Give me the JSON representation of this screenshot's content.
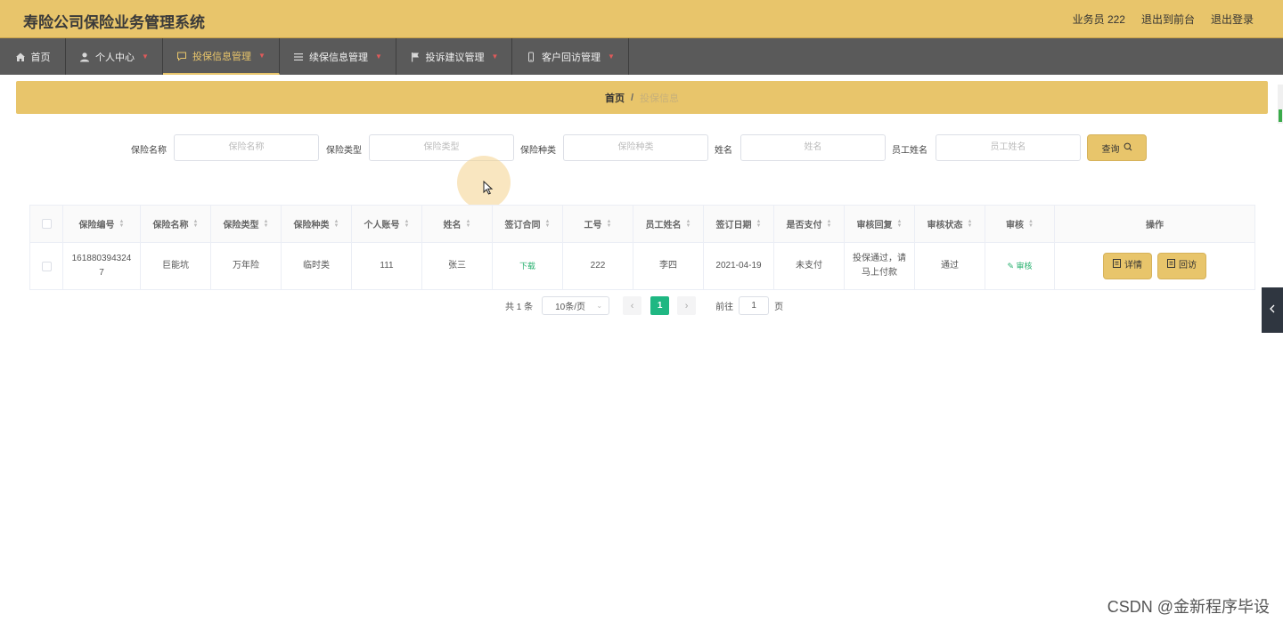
{
  "header": {
    "title": "寿险公司保险业务管理系统",
    "user_label": "业务员 222",
    "front_link": "退出到前台",
    "logout": "退出登录",
    "bg_color": "#e8c56b"
  },
  "nav": {
    "items": [
      {
        "label": "首页",
        "icon": "home-icon"
      },
      {
        "label": "个人中心",
        "icon": "user-icon"
      },
      {
        "label": "投保信息管理",
        "icon": "message-icon"
      },
      {
        "label": "续保信息管理",
        "icon": "list-icon"
      },
      {
        "label": "投诉建议管理",
        "icon": "flag-icon"
      },
      {
        "label": "客户回访管理",
        "icon": "phone-icon"
      }
    ],
    "active_index": 2,
    "bg_color": "#5a5a5a"
  },
  "breadcrumb": {
    "home": "首页",
    "separator": "/",
    "current": "投保信息"
  },
  "search": {
    "fields": [
      {
        "label": "保险名称",
        "placeholder": "保险名称"
      },
      {
        "label": "保险类型",
        "placeholder": "保险类型"
      },
      {
        "label": "保险种类",
        "placeholder": "保险种类"
      },
      {
        "label": "姓名",
        "placeholder": "姓名"
      },
      {
        "label": "员工姓名",
        "placeholder": "员工姓名"
      }
    ],
    "button_label": "查询"
  },
  "table": {
    "columns": [
      "保险编号",
      "保险名称",
      "保险类型",
      "保险种类",
      "个人账号",
      "姓名",
      "签订合同",
      "工号",
      "员工姓名",
      "签订日期",
      "是否支付",
      "审核回复",
      "审核状态",
      "审核",
      "操作"
    ],
    "rows": [
      {
        "policy_no": "1618803943247",
        "insurance_name": "巨能坑",
        "insurance_type": "万年险",
        "insurance_kind": "临时类",
        "account": "111",
        "name": "张三",
        "contract": "下载",
        "staff_no": "222",
        "staff_name": "李四",
        "sign_date": "2021-04-19",
        "paid": "未支付",
        "review_reply": "投保通过，请马上付款",
        "review_status": "通过",
        "review_action": "审核",
        "detail_button": "详情",
        "visit_button": "回访"
      }
    ]
  },
  "pagination": {
    "total": "共 1 条",
    "page_size": "10条/页",
    "current_page": "1",
    "goto_label": "前往",
    "goto_value": "1",
    "page_suffix": "页"
  },
  "watermark": "CSDN @金新程序毕设",
  "colors": {
    "accent": "#e8c56b",
    "active_page": "#1fb782",
    "link_green": "#27b06e"
  }
}
